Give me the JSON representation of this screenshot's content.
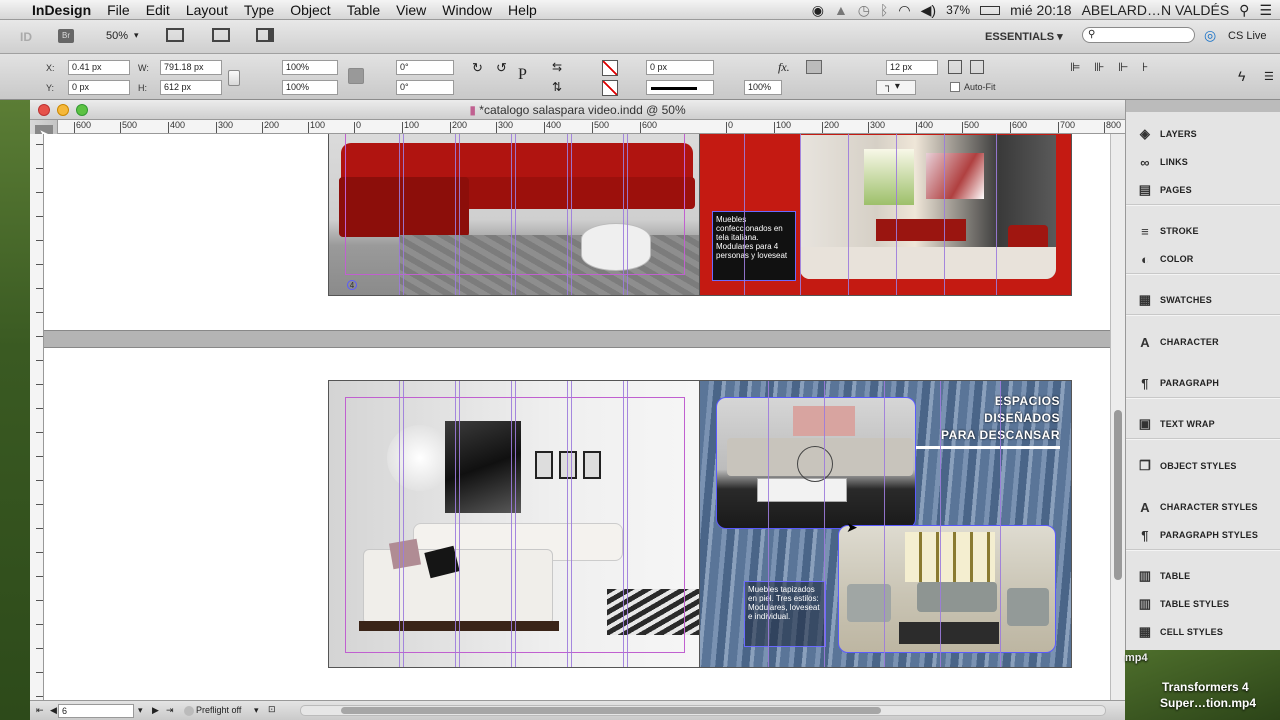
{
  "menubar": {
    "apple": "",
    "app_name": "InDesign",
    "items": [
      "File",
      "Edit",
      "Layout",
      "Type",
      "Object",
      "Table",
      "View",
      "Window",
      "Help"
    ],
    "battery": "37%",
    "clock": "mié 20:18",
    "user": "ABELARD…N VALDÉS"
  },
  "appbar": {
    "logo": "ID",
    "bridge": "Br",
    "zoom": "50%",
    "workspace": "ESSENTIALS ▾",
    "cs_live": "CS Live"
  },
  "control": {
    "x_label": "X:",
    "x_value": "0.41 px",
    "y_label": "Y:",
    "y_value": "0 px",
    "w_label": "W:",
    "w_value": "791.18 px",
    "h_label": "H:",
    "h_value": "612 px",
    "scale_x": "100%",
    "scale_y": "100%",
    "rotate": "0°",
    "shear": "0°",
    "stroke_weight": "0 px",
    "opacity": "100%",
    "offset": "12 px",
    "autofit": "Auto-Fit"
  },
  "document": {
    "title": "*catalogo salaspara video.indd @ 50%",
    "ruler_h": [
      "600",
      "500",
      "400",
      "300",
      "200",
      "100",
      "0",
      "100",
      "200",
      "300",
      "400",
      "500",
      "600",
      "0",
      "100",
      "200",
      "300",
      "400",
      "500",
      "600",
      "700",
      "800"
    ],
    "page_badge": "4",
    "text_top": "Muebles confeccionados en tela italiana. Modulares para 4 personas y loveseat",
    "text_bottom": "Muebles tapizados en piel. Tres estilos: Modulares, loveseat e individual.",
    "heading_lines": [
      "ESPACIOS",
      "DISEÑADOS",
      "PARA DESCANSAR"
    ]
  },
  "statusbar": {
    "page_number": "6",
    "preflight": "Preflight off"
  },
  "panels": [
    {
      "label": "LAYERS",
      "icon": "◈"
    },
    {
      "label": "LINKS",
      "icon": "∞"
    },
    {
      "label": "PAGES",
      "icon": "▤"
    },
    {
      "label": "STROKE",
      "icon": "≡"
    },
    {
      "label": "COLOR",
      "icon": "◐"
    },
    {
      "label": "SWATCHES",
      "icon": "▦"
    },
    {
      "label": "CHARACTER",
      "icon": "A"
    },
    {
      "label": "PARAGRAPH",
      "icon": "¶"
    },
    {
      "label": "TEXT WRAP",
      "icon": "▣"
    },
    {
      "label": "OBJECT STYLES",
      "icon": "❐"
    },
    {
      "label": "CHARACTER STYLES",
      "icon": "A"
    },
    {
      "label": "PARAGRAPH STYLES",
      "icon": "¶"
    },
    {
      "label": "TABLE",
      "icon": "▥"
    },
    {
      "label": "TABLE STYLES",
      "icon": "▥"
    },
    {
      "label": "CELL STYLES",
      "icon": "▦"
    }
  ],
  "desktop": {
    "file_label_1": "Transformers 4",
    "file_label_2": "Super…tion.mp4",
    "file_label_top": "mp4"
  },
  "colors": {
    "accent_red": "#c41a12",
    "guide": "#9c7bdc",
    "blue_bg": "#6a84a8"
  }
}
